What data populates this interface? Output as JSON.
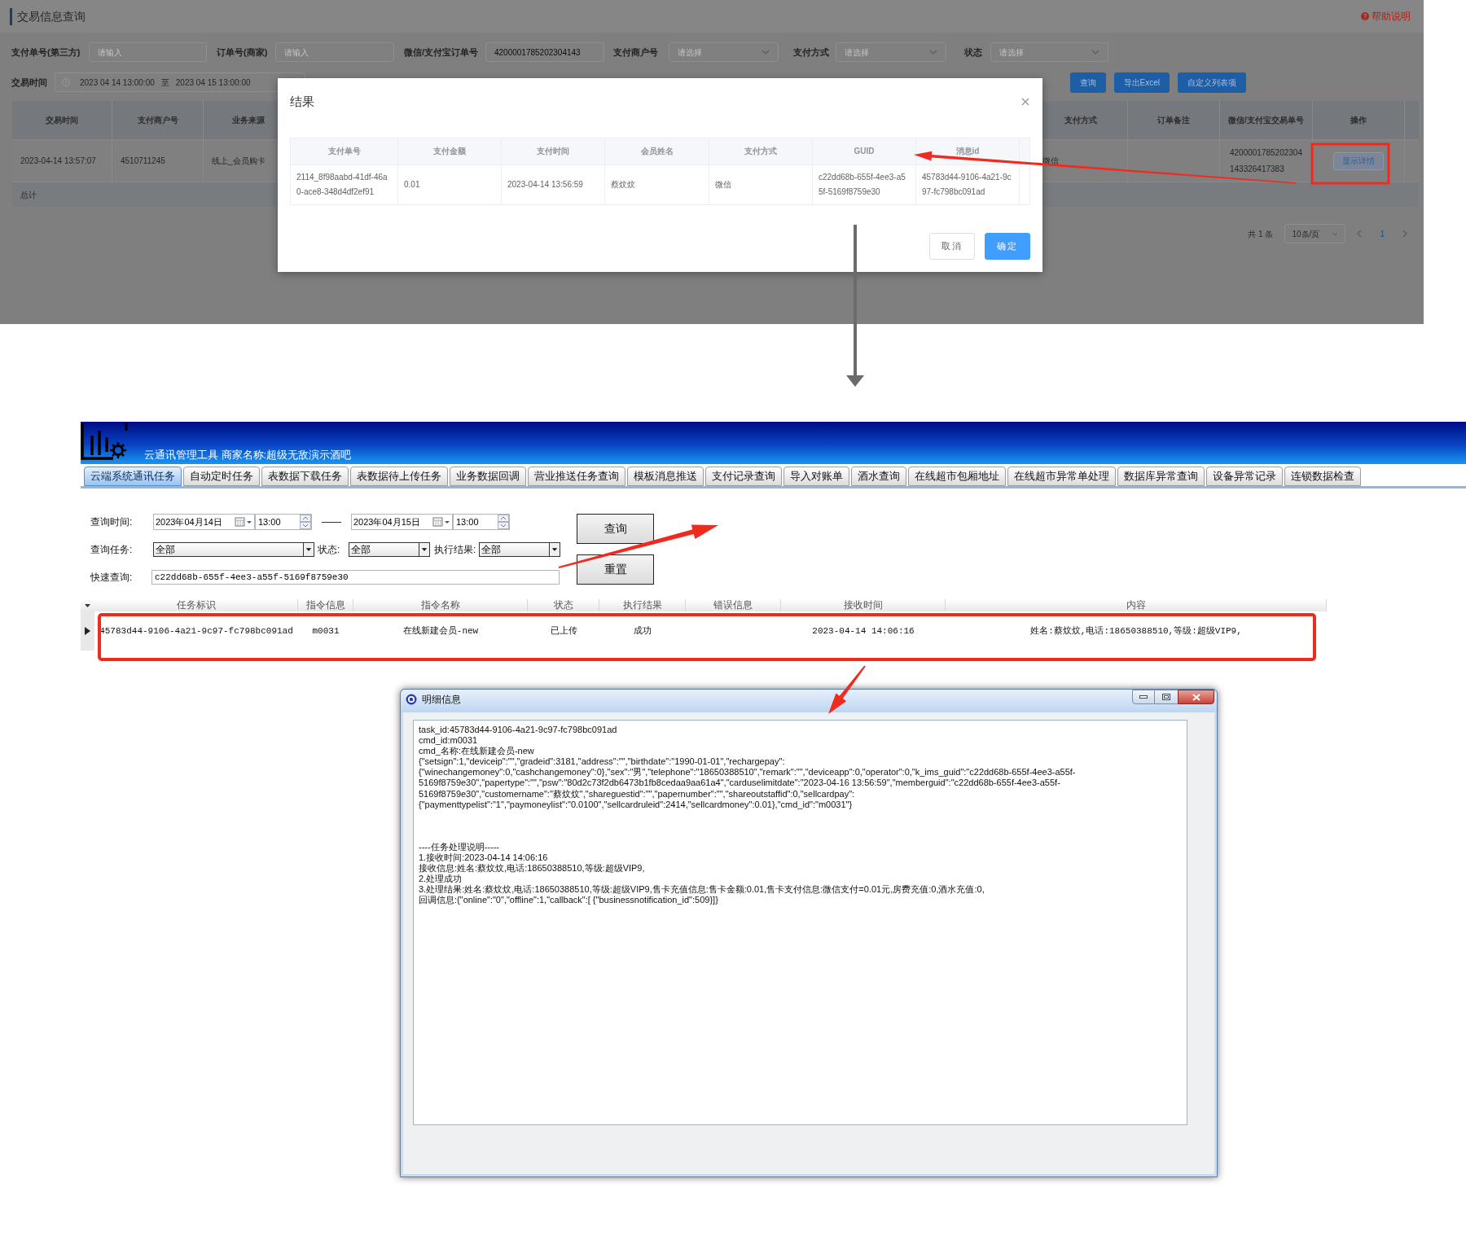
{
  "web_page": {
    "title": "交易信息查询",
    "help_link": "帮助说明",
    "filters": [
      {
        "label": "支付单号(第三方)",
        "kind": "input",
        "placeholder": "请输入"
      },
      {
        "label": "订单号(商家)",
        "kind": "input",
        "placeholder": "请输入"
      },
      {
        "label": "微信/支付宝订单号",
        "kind": "input",
        "value": "4200001785202304143"
      },
      {
        "label": "支付商户号",
        "kind": "select",
        "placeholder": "请选择"
      },
      {
        "label": "支付方式",
        "kind": "select",
        "placeholder": "请选择"
      },
      {
        "label": "状态",
        "kind": "select",
        "placeholder": "请选择"
      }
    ],
    "date_range": {
      "label": "交易时间",
      "start": "2023 04 14 13:00:00",
      "separator": "至",
      "end": "2023 04 15 13:00:00"
    },
    "buttons": [
      "查询",
      "导出Excel",
      "自定义列表项"
    ],
    "table": {
      "columns": [
        "交易时间",
        "支付商户号",
        "业务来源",
        "支付方式",
        "订单备注",
        "微信/支付宝交易单号",
        "操作"
      ],
      "rows": [
        {
          "time": "2023-04-14 13:57:07",
          "merchant_no": "4510711245",
          "source": "线上_会员购卡",
          "pay_method": "微信",
          "trade_no": "4200001785202304143326417383",
          "action": "显示详情"
        }
      ],
      "total_label": "总计"
    },
    "pagination": {
      "total": "共 1 条",
      "page_size": "10条/页",
      "pages": [
        {
          "label": "1",
          "selected": true
        }
      ]
    }
  },
  "result_dialog": {
    "title": "结果",
    "columns": [
      "支付单号",
      "支付金额",
      "支付时间",
      "会员姓名",
      "支付方式",
      "GUID",
      "消息id"
    ],
    "rows": [
      [
        "2114_8f98aabd-41df-46a0-ace8-348d4df2ef91",
        "0.01",
        "2023-04-14 13:56:59",
        "蔡炆炆",
        "微信",
        "c22dd68b-655f-4ee3-a55f-5169f8759e30",
        "45783d44-9106-4a21-9c97-fc798bc091ad"
      ]
    ],
    "buttons": [
      {
        "label": "取消",
        "kind": "secondary"
      },
      {
        "label": "确定",
        "kind": "primary"
      }
    ]
  },
  "desktop_app": {
    "title": "云通讯管理工具 商家名称:超级无敌演示酒吧",
    "tabs": [
      {
        "label": "云端系统通讯任务",
        "selected": true
      },
      {
        "label": "自动定时任务",
        "selected": false
      },
      {
        "label": "表数据下载任务",
        "selected": false
      },
      {
        "label": "表数据待上传任务",
        "selected": false
      },
      {
        "label": "业务数据回调",
        "selected": false
      },
      {
        "label": "营业推送任务查询",
        "selected": false
      },
      {
        "label": "模板消息推送",
        "selected": false
      },
      {
        "label": "支付记录查询",
        "selected": false
      },
      {
        "label": "导入对账单",
        "selected": false
      },
      {
        "label": "酒水查询",
        "selected": false
      },
      {
        "label": "在线超市包厢地址",
        "selected": false
      },
      {
        "label": "在线超市异常单处理",
        "selected": false
      },
      {
        "label": "数据库异常查询",
        "selected": false
      },
      {
        "label": "设备异常记录",
        "selected": false
      },
      {
        "label": "连锁数据检查",
        "selected": false
      }
    ],
    "query_time": {
      "label": "查询时间:",
      "start_date": "2023年04月14日",
      "start_time": "13:00",
      "separator": "——",
      "end_date": "2023年04月15日",
      "end_time": "13:00"
    },
    "task_filter": {
      "label": "查询任务:",
      "value": "全部"
    },
    "status_filter": {
      "label": "状态:",
      "value": "全部"
    },
    "result_filter": {
      "label": "执行结果:",
      "value": "全部"
    },
    "quick_search": {
      "label": "快速查询:",
      "value": "c22dd68b-655f-4ee3-a55f-5169f8759e30"
    },
    "buttons": [
      "查询",
      "重置"
    ],
    "grid": {
      "columns": [
        "任务标识",
        "指令信息",
        "指令名称",
        "状态",
        "执行结果",
        "错误信息",
        "接收时间",
        "内容"
      ],
      "rows": [
        {
          "current": true,
          "task_id": "45783d44-9106-4a21-9c97-fc798bc091ad",
          "cmd_info": "m0031",
          "cmd_name": "在线新建会员-new",
          "status": "已上传",
          "result": "成功",
          "received_at": "2023-04-14 14:06:16",
          "content": "姓名:蔡炆炆,电话:18650388510,等级:超级VIP9,"
        }
      ]
    }
  },
  "detail_window": {
    "title": "明细信息",
    "lines": [
      "task_id:45783d44-9106-4a21-9c97-fc798bc091ad",
      "cmd_id:m0031",
      "cmd_名称:在线新建会员-new",
      "{\"setsign\":1,\"deviceip\":\"\",\"gradeid\":3181,\"address\":\"\",\"birthdate\":\"1990-01-01\",\"rechargepay\":",
      "{\"winechangemoney\":0,\"cashchangemoney\":0},\"sex\":\"男\",\"telephone\":\"18650388510\",\"remark\":\"\",\"deviceapp\":0,\"operator\":0,\"k_ims_guid\":\"c22dd68b-655f-4ee3-a55f-",
      "5169f8759e30\",\"papertype\":\"\",\"psw\":\"80d2c73f2db6473b1fb8cedaa9aa61a4\",\"carduselimitdate\":\"2023-04-16 13:56:59\",\"memberguid\":\"c22dd68b-655f-4ee3-a55f-",
      "5169f8759e30\",\"customername\":\"蔡炆炆\",\"shareguestid\":\"\",\"papernumber\":\"\",\"shareoutstaffid\":0,\"sellcardpay\":",
      "{\"paymenttypelist\":\"1\",\"paymoneylist\":\"0.0100\",\"sellcardruleid\":2414,\"sellcardmoney\":0.01},\"cmd_id\":\"m0031\"}"
    ],
    "notes": [
      "----任务处理说明-----",
      "1.接收时间:2023-04-14 14:06:16",
      "接收信息:姓名:蔡炆炆,电话:18650388510,等级:超级VIP9,",
      "2.处理成功",
      "3.处理结果:姓名:蔡炆炆,电话:18650388510,等级:超级VIP9,售卡充值信息:售卡金额:0.01,售卡支付信息:微信支付=0.01元,房费充值:0,酒水充值:0,",
      "回调信息:{\"online\":\"0\",\"offline\":1,\"callback\":[ {\"businessnotification_id\":509}]}"
    ]
  }
}
